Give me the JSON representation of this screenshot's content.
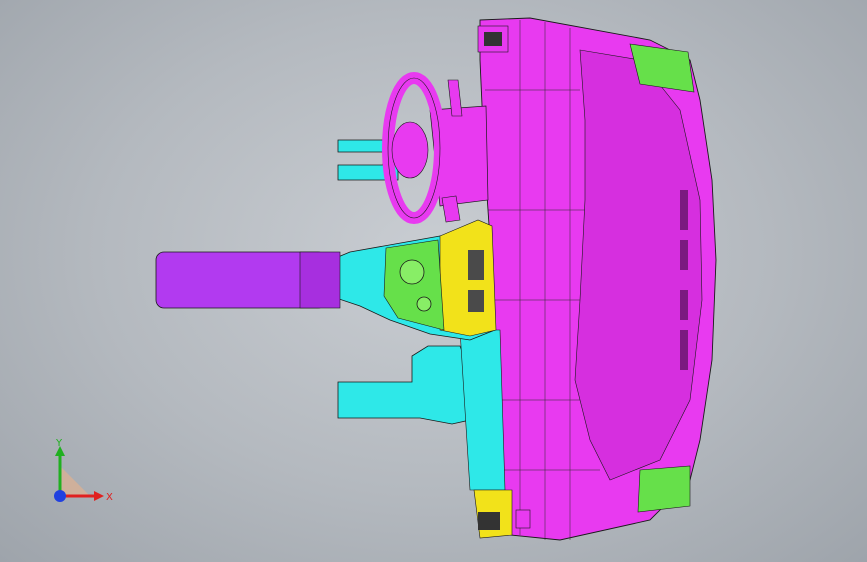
{
  "viewport": {
    "background": "#b4b9bf",
    "model": {
      "name": "dashboard-assembly",
      "colors": {
        "magenta": "#e83af0",
        "magenta_dark": "#c21fc8",
        "purple": "#b23af0",
        "cyan": "#2ee8e8",
        "yellow": "#f2e21a",
        "green": "#66e04a",
        "edge": "#1a1a1a"
      }
    },
    "triad": {
      "x_label": "X",
      "y_label": "Y",
      "x_color": "#e02020",
      "y_color": "#20b020",
      "z_color": "#2040e0"
    }
  }
}
